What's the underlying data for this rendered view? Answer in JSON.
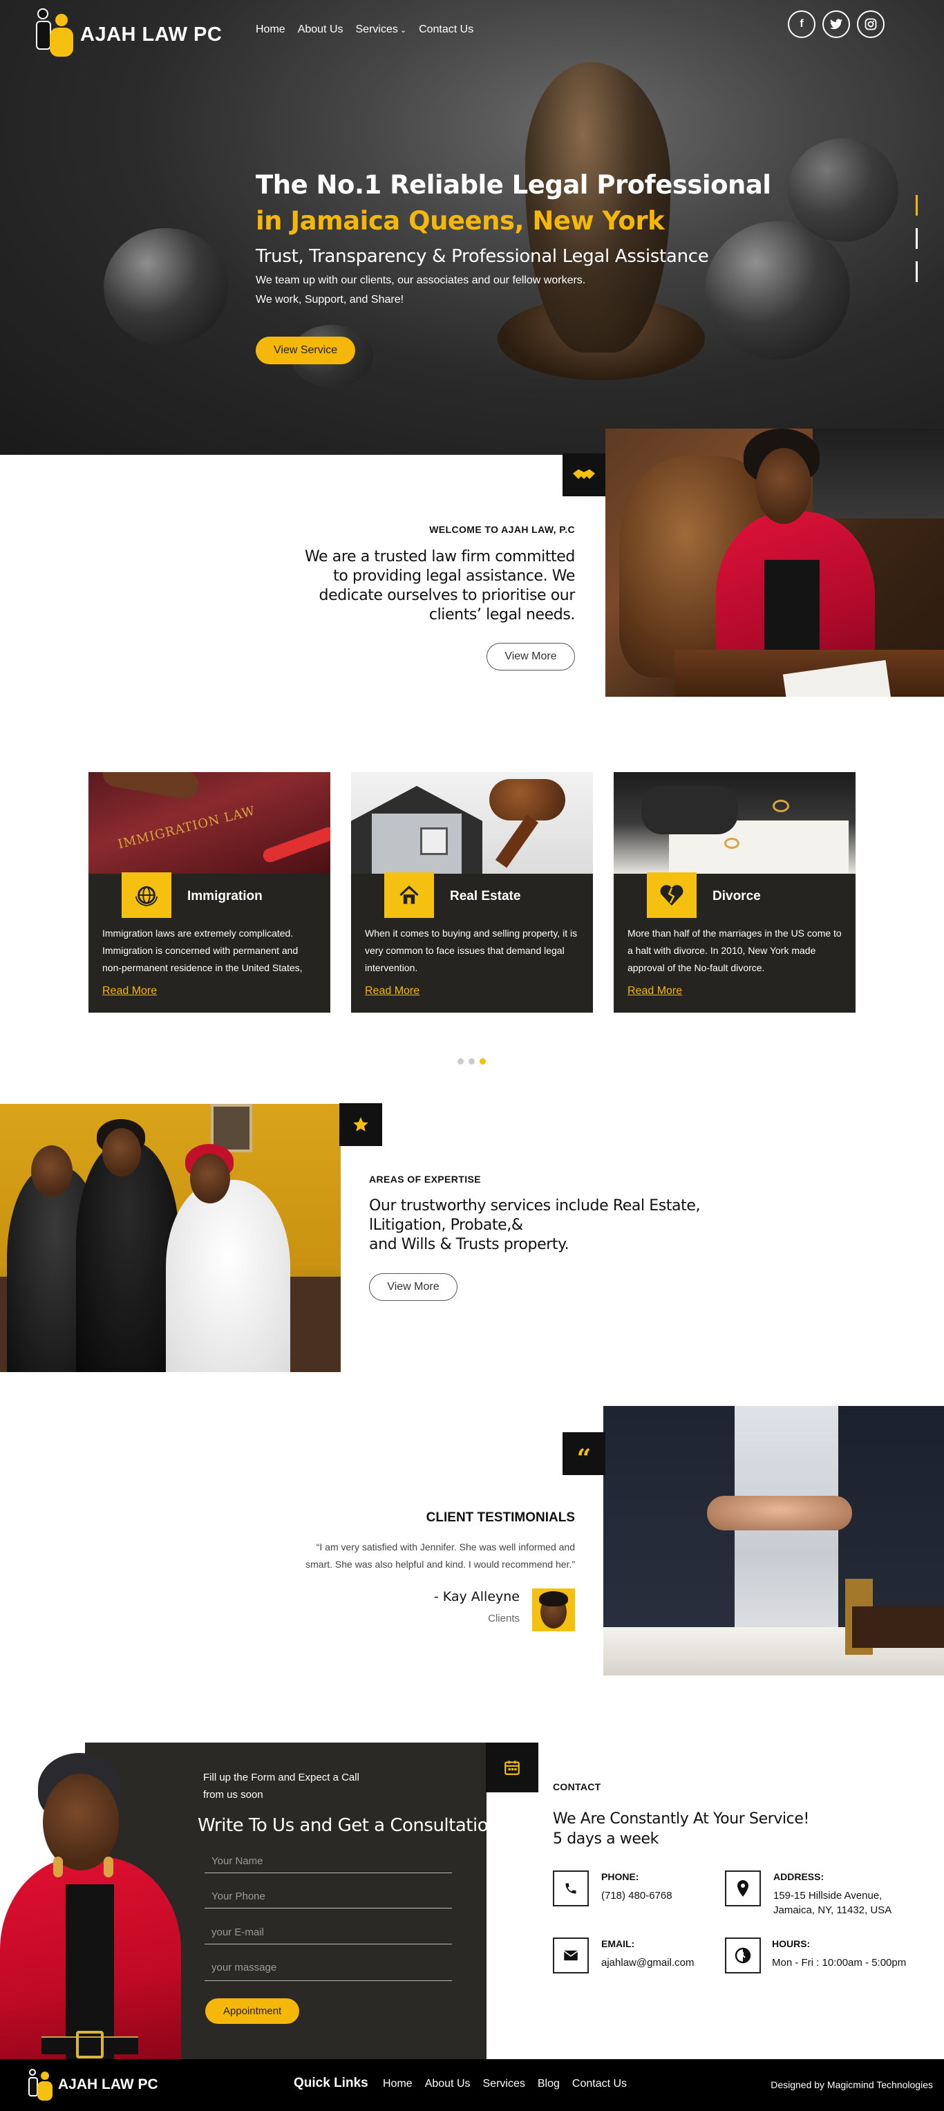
{
  "header": {
    "brand": "AJAH LAW PC",
    "nav": [
      {
        "label": "Home"
      },
      {
        "label": "About Us"
      },
      {
        "label": "Services"
      },
      {
        "label": "Contact Us"
      }
    ],
    "social": [
      {
        "icon": "facebook-icon",
        "glyph": "f"
      },
      {
        "icon": "twitter-icon",
        "glyph": "t"
      },
      {
        "icon": "instagram-icon",
        "glyph": "◎"
      }
    ]
  },
  "hero": {
    "title": "The No.1 Reliable Legal Professional",
    "subtitle": "in Jamaica Queens, New York",
    "tagline": "Trust, Transparency & Professional Legal Assistance",
    "line1": "We team up with our clients, our associates and our fellow workers.",
    "line2": "We work, Support, and Share!",
    "button": "View Service"
  },
  "about": {
    "label": "WELCOME TO AJAH LAW, P.C",
    "text_lines": [
      "We are a trusted law firm committed",
      "to providing legal assistance. We",
      "dedicate ourselves to prioritise our",
      "clients’ legal needs."
    ],
    "button": "View More",
    "icon": "handshake-icon"
  },
  "services": [
    {
      "title": "Immigration",
      "icon": "globe-icon",
      "image_text": "IMMIGRATION LAW",
      "body": "Immigration laws are extremely complicated. Immigration is concerned with permanent and non-permanent residence in the United States,",
      "link": "Read More"
    },
    {
      "title": "Real Estate",
      "icon": "house-icon",
      "body": "When it comes to buying and selling property, it is very common to face issues that demand legal intervention.",
      "link": "Read More"
    },
    {
      "title": "Divorce",
      "icon": "broken-heart-icon",
      "body": "More than half of the marriages in the US come to a halt with divorce. In 2010, New York made approval of the No-fault divorce.",
      "link": "Read More"
    }
  ],
  "carousel": {
    "pages": 3,
    "active": 3
  },
  "expertise": {
    "label": "AREAS OF EXPERTISE",
    "text_lines": [
      "Our trustworthy services include Real Estate,",
      "lLitigation, Probate,&",
      "and Wills & Trusts property."
    ],
    "button": "View More",
    "icon": "star-icon"
  },
  "testimonial": {
    "title": "CLIENT TESTIMONIALS",
    "quote_line1": "“I am very satisfied with Jennifer. She was well informed and",
    "quote_line2": "smart. She was also helpful and kind. I would recommend her.”",
    "author": "- Kay Alleyne",
    "role": "Clients",
    "icon": "quote-icon"
  },
  "form": {
    "intro_line1": "Fill up the Form and Expect a Call",
    "intro_line2": "from us soon",
    "heading": "Write To Us and Get a Consultation",
    "placeholders": {
      "name": "Your Name",
      "phone": "Your Phone",
      "email": "your E-mail",
      "message": "your massage"
    },
    "button": "Appointment",
    "icon": "calendar-icon"
  },
  "contact": {
    "label": "CONTACT",
    "heading_line1": "We Are Constantly At Your Service!",
    "heading_line2": "5 days a week",
    "phone_label": "PHONE:",
    "phone": "(718) 480-6768",
    "address_label": "ADDRESS:",
    "address_line1": "159-15 Hillside Avenue,",
    "address_line2": "Jamaica, NY, 11432, USA",
    "email_label": "EMAIL:",
    "email": "ajahlaw@gmail.com",
    "hours_label": "HOURS:",
    "hours": "Mon - Fri : 10:00am - 5:00pm"
  },
  "footer": {
    "brand": "AJAH LAW PC",
    "quick_links_title": "Quick Links",
    "links": [
      {
        "label": "Home"
      },
      {
        "label": "About Us"
      },
      {
        "label": "Services"
      },
      {
        "label": "Blog"
      },
      {
        "label": "Contact Us"
      }
    ],
    "credit": "Designed by Magicmind Technologies"
  },
  "colors": {
    "accent": "#f5b80a",
    "dark": "#262421",
    "black": "#000000"
  }
}
